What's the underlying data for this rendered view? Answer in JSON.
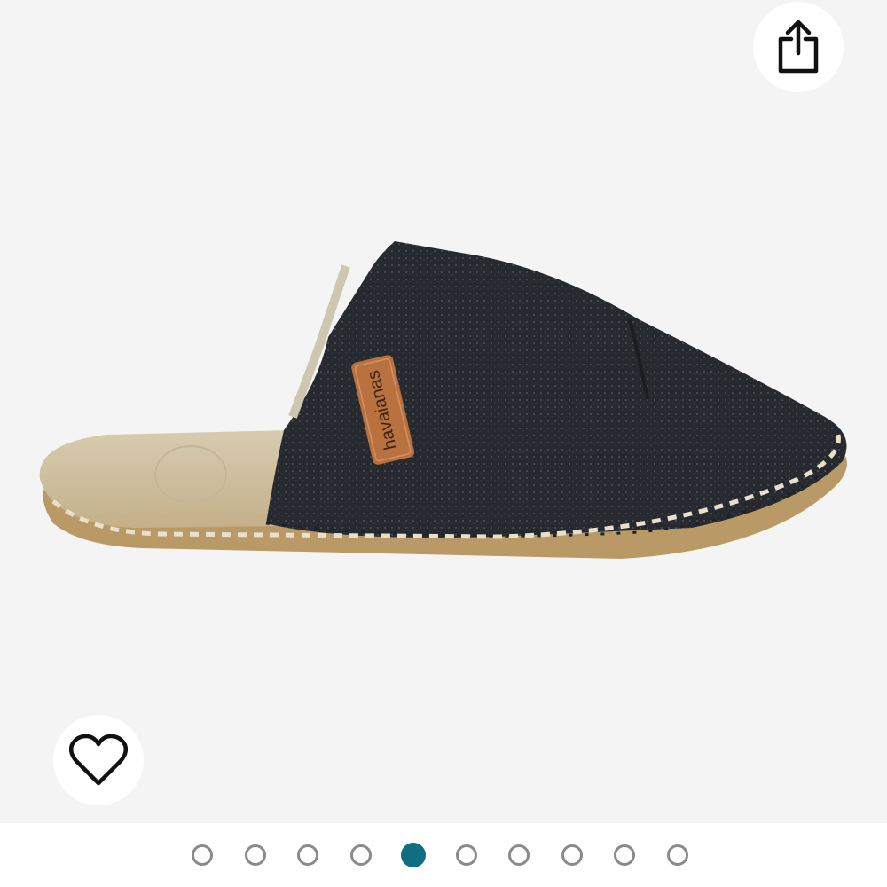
{
  "gallery": {
    "image": {
      "brand_tag_text": "havaianas"
    },
    "share_button": {
      "icon": "share-icon"
    },
    "wishlist_button": {
      "icon": "heart-outline-icon"
    },
    "pagination": {
      "total": 10,
      "active_index": 4,
      "active_color": "#0f6f80",
      "inactive_color": "#8a8a8a"
    }
  }
}
